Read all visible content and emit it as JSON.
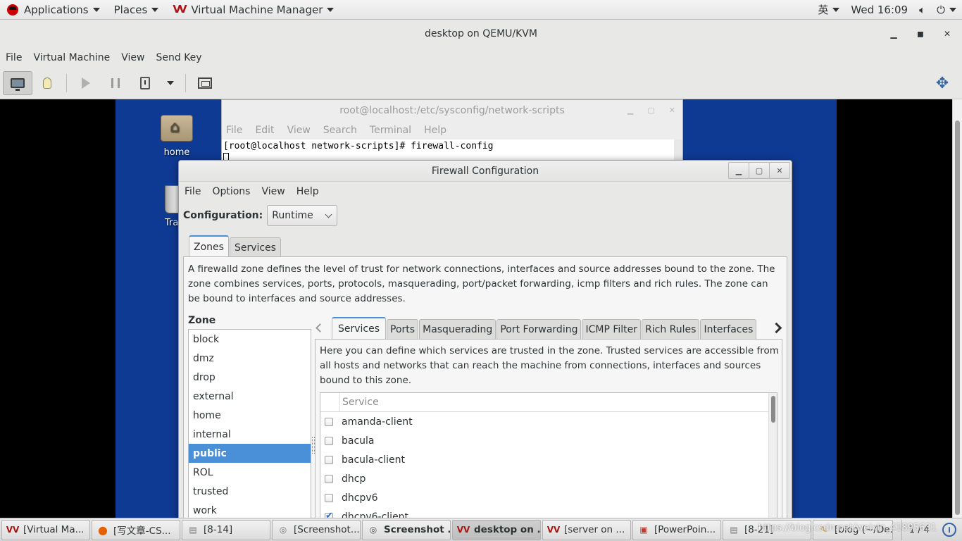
{
  "topbar": {
    "applications": "Applications",
    "places": "Places",
    "app_menu": "Virtual Machine Manager",
    "input_method": "英",
    "clock": "Wed 16:09"
  },
  "vm_window": {
    "title": "desktop on QEMU/KVM",
    "menu": [
      "File",
      "Virtual Machine",
      "View",
      "Send Key"
    ]
  },
  "guest_desktop": {
    "icons": [
      {
        "label": "home"
      },
      {
        "label": "Tra"
      }
    ]
  },
  "terminal": {
    "title": "root@localhost:/etc/sysconfig/network-scripts",
    "menu": [
      "File",
      "Edit",
      "View",
      "Search",
      "Terminal",
      "Help"
    ],
    "prompt": "[root@localhost network-scripts]# firewall-config"
  },
  "firewall": {
    "title": "Firewall Configuration",
    "menu": [
      "File",
      "Options",
      "View",
      "Help"
    ],
    "config_label": "Configuration:",
    "config_value": "Runtime",
    "main_tabs": [
      "Zones",
      "Services"
    ],
    "zone_description": "A firewalld zone defines the level of trust for network connections, interfaces and source addresses bound to the zone. The zone combines services, ports, protocols, masquerading, port/packet forwarding, icmp filters and rich rules. The zone can be bound to interfaces and source addresses.",
    "zone_label": "Zone",
    "zones": [
      "block",
      "dmz",
      "drop",
      "external",
      "home",
      "internal",
      "public",
      "ROL",
      "trusted",
      "work"
    ],
    "selected_zone": "public",
    "sub_tabs": [
      "Services",
      "Ports",
      "Masquerading",
      "Port Forwarding",
      "ICMP Filter",
      "Rich Rules",
      "Interfaces"
    ],
    "services_description": "Here you can define which services are trusted in the zone. Trusted services are accessible from all hosts and networks that can reach the machine from connections, interfaces and sources bound to this zone.",
    "service_header": "Service",
    "services": [
      {
        "name": "amanda-client",
        "checked": false
      },
      {
        "name": "bacula",
        "checked": false
      },
      {
        "name": "bacula-client",
        "checked": false
      },
      {
        "name": "dhcp",
        "checked": false
      },
      {
        "name": "dhcpv6",
        "checked": false
      },
      {
        "name": "dhcpv6-client",
        "checked": true
      }
    ]
  },
  "taskbar": {
    "tasks": [
      {
        "label": "[Virtual Ma...",
        "icon": "vmm-icon"
      },
      {
        "label": "[写文章-CS...",
        "icon": "firefox-icon"
      },
      {
        "label": "[8-14]",
        "icon": "folder-icon"
      },
      {
        "label": "[Screenshot...",
        "icon": "screenshot-icon"
      },
      {
        "label": "Screenshot ...",
        "icon": "screenshot-icon"
      },
      {
        "label": "desktop on ...",
        "icon": "vmm-icon",
        "active": true
      },
      {
        "label": "[server on ...",
        "icon": "vmm-icon"
      },
      {
        "label": "[PowerPoin...",
        "icon": "presentation-icon"
      },
      {
        "label": "[8-21]",
        "icon": "folder-icon"
      },
      {
        "label": "[blog (~/De...",
        "icon": "text-editor-icon"
      }
    ],
    "pager": "1 / 4",
    "watermark": "https://blog.csdn.net/weixin_41895631"
  },
  "colors": {
    "selection": "#4a90d9",
    "desktop_bg": "#0f3a93",
    "accent": "#3465a4"
  }
}
